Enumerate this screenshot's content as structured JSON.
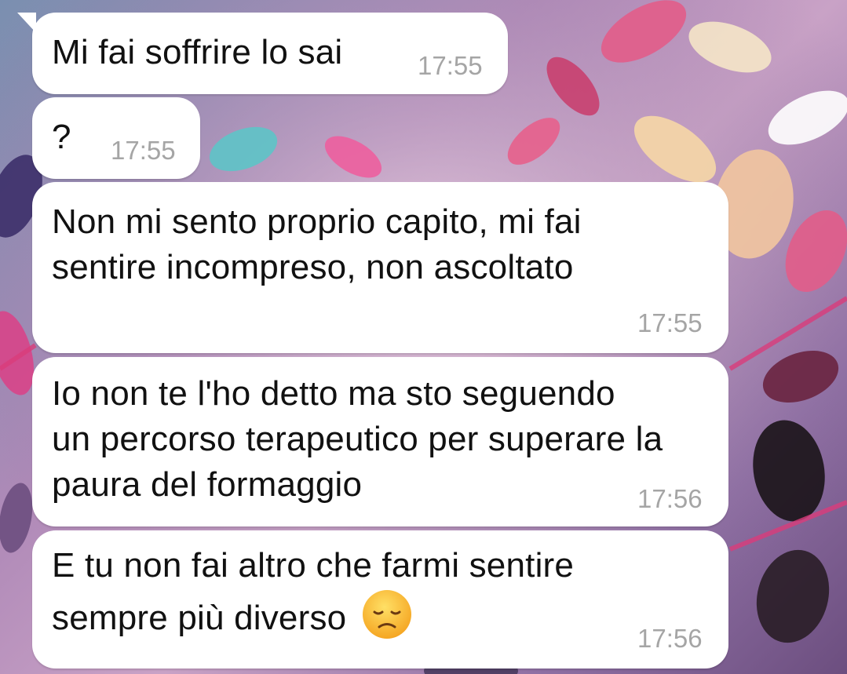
{
  "messages": [
    {
      "text": "Mi fai soffrire lo sai",
      "time": "17:55"
    },
    {
      "text": "?",
      "time": "17:55"
    },
    {
      "text": "Non mi sento proprio capito, mi fai\nsentire incompreso, non ascoltato",
      "time": "17:55"
    },
    {
      "text": "Io non te l'ho detto ma sto seguendo\nun percorso terapeutico per superare la\npaura del formaggio",
      "time": "17:56"
    },
    {
      "text": "E tu non fai altro che farmi sentire\nsempre più diverso ",
      "time": "17:56",
      "emoji": "disappointed-face-icon"
    }
  ],
  "colors": {
    "bubble": "#ffffff",
    "text": "#111111",
    "timestamp": "#a5a5a5"
  }
}
